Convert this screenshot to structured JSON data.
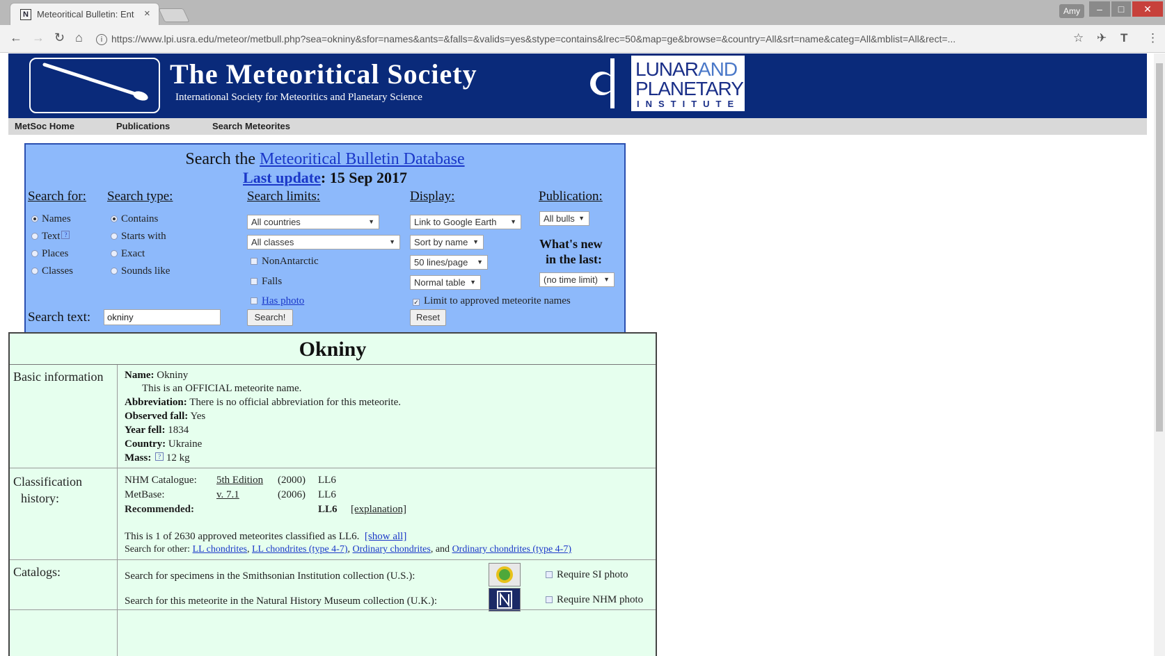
{
  "browser": {
    "tab_title": "Meteoritical Bulletin: Ent",
    "tab_close": "×",
    "url": "https://www.lpi.usra.edu/meteor/metbull.php?sea=okniny&sfor=names&ants=&falls=&valids=yes&stype=contains&lrec=50&map=ge&browse=&country=All&srt=name&categ=All&mblist=All&rect=...",
    "user_button": "Amy",
    "icons": [
      "back-icon",
      "forward-icon",
      "reload-icon",
      "home-icon",
      "info-icon",
      "star-icon",
      "extension-icon",
      "extension-icon",
      "menu-icon"
    ]
  },
  "site": {
    "title": "The Meteoritical Society",
    "subtitle": "International Society for Meteoritics and Planetary Science",
    "partner_line1": "LUNAR",
    "partner_and": "AND",
    "partner_line2": "PLANETARY",
    "partner_line3": "INSTITUTE",
    "nav": [
      "MetSoc Home",
      "Publications",
      "Search Meteorites"
    ]
  },
  "search": {
    "title_prefix": "Search the ",
    "title_link": "Meteoritical Bulletin Database",
    "update_link": "Last update",
    "update_date": ": 15 Sep 2017",
    "headers": {
      "search_for": "Search for:",
      "search_type": "Search type:",
      "search_limits": "Search limits:",
      "display": "Display:",
      "publication": "Publication:"
    },
    "search_for": [
      "Names",
      "Text",
      "Places",
      "Classes"
    ],
    "search_type": [
      "Contains",
      "Starts with",
      "Exact",
      "Sounds like"
    ],
    "limits": {
      "country": "All countries",
      "classes": "All classes",
      "nonantarctic": "NonAntarctic",
      "falls": "Falls",
      "has_photo": "Has photo"
    },
    "display": {
      "map": "Link to Google Earth",
      "sort": "Sort by name",
      "lines": "50 lines/page",
      "table": "Normal table"
    },
    "publication": {
      "bulls": "All bulls",
      "whats_new_1": "What's new",
      "whats_new_2": "in the last:",
      "time": "(no time limit)"
    },
    "approved_label": "Limit to approved meteorite names",
    "text_label": "Search text:",
    "text_value": "okniny",
    "search_button": "Search!",
    "reset_button": "Reset"
  },
  "result": {
    "name": "Okniny",
    "basic": {
      "label": "Basic information",
      "name_label": "Name:",
      "name_value": " Okniny",
      "official_note": "This is an OFFICIAL meteorite name.",
      "abbr_label": "Abbreviation:",
      "abbr_value": " There is no official abbreviation for this meteorite.",
      "fall_label": "Observed fall:",
      "fall_value": " Yes",
      "year_label": "Year fell:",
      "year_value": " 1834",
      "country_label": "Country:",
      "country_value": " Ukraine",
      "mass_label": "Mass:",
      "mass_value": "12 kg"
    },
    "classification": {
      "label1": "Classification",
      "label2": "history:",
      "nhm_source": "NHM Catalogue:",
      "nhm_link": "5th Edition",
      "nhm_year": "(2000)",
      "nhm_class": "LL6",
      "metbase_source": "MetBase:",
      "metbase_link": "v. 7.1",
      "metbase_year": "(2006)",
      "metbase_class": "LL6",
      "rec_label": "Recommended:",
      "rec_class": "LL6",
      "explanation_link": "[explanation]",
      "count_text": "This is 1 of 2630 approved meteorites classified as LL6.",
      "show_all_link": "[show all]",
      "search_other_label": "Search for other: ",
      "other_links": [
        "LL chondrites",
        "LL chondrites (type 4-7)",
        "Ordinary chondrites",
        "Ordinary chondrites (type 4-7)"
      ],
      "and_word": ", and "
    },
    "catalogs": {
      "label": "Catalogs:",
      "si_text": "Search for specimens in the Smithsonian Institution collection (U.S.):",
      "si_check": "Require SI photo",
      "nhm_text": "Search for this meteorite in the Natural History Museum collection (U.K.):",
      "nhm_check": "Require NHM photo"
    }
  }
}
